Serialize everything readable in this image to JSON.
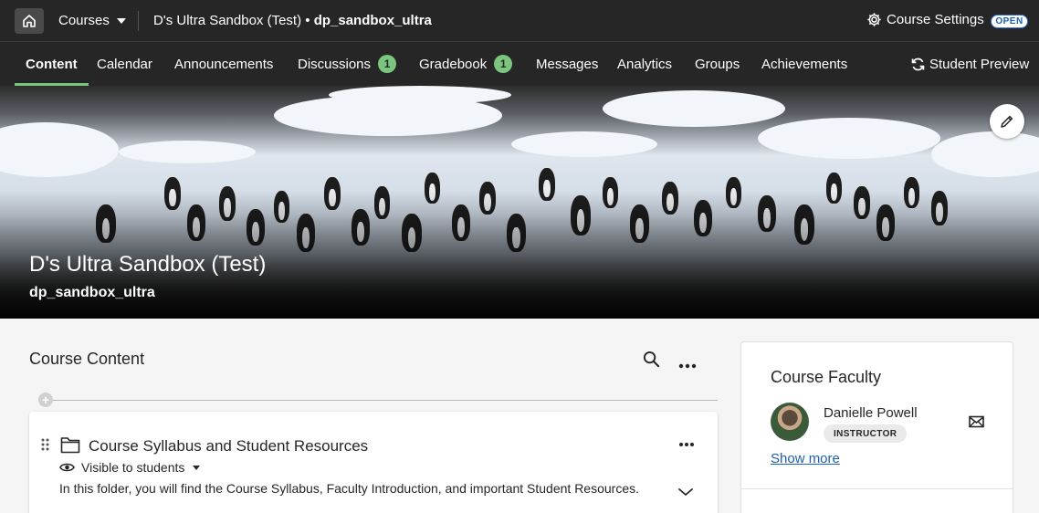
{
  "topbar": {
    "courses_label": "Courses",
    "course_name": "D's Ultra Sandbox (Test)",
    "separator": " • ",
    "course_id": "dp_sandbox_ultra",
    "settings_label": "Course Settings",
    "status_badge": "OPEN"
  },
  "nav": {
    "items": [
      {
        "label": "Content"
      },
      {
        "label": "Calendar"
      },
      {
        "label": "Announcements"
      },
      {
        "label": "Discussions",
        "count": "1"
      },
      {
        "label": "Gradebook",
        "count": "1"
      },
      {
        "label": "Messages"
      },
      {
        "label": "Analytics"
      },
      {
        "label": "Groups"
      },
      {
        "label": "Achievements"
      }
    ],
    "student_preview": "Student Preview"
  },
  "banner": {
    "title": "D's Ultra Sandbox (Test)",
    "subtitle": "dp_sandbox_ultra"
  },
  "content": {
    "title": "Course Content",
    "items": [
      {
        "title": "Course Syllabus and Student Resources",
        "visibility": "Visible to students",
        "description": "In this folder, you will find the Course Syllabus, Faculty Introduction, and important Student Resources."
      }
    ]
  },
  "faculty": {
    "title": "Course Faculty",
    "name": "Danielle Powell",
    "role": "INSTRUCTOR",
    "show_more": "Show more"
  },
  "colors": {
    "dark_bg": "#262626",
    "accent_green": "#7bc67e",
    "link_blue": "#1d5fb0"
  }
}
